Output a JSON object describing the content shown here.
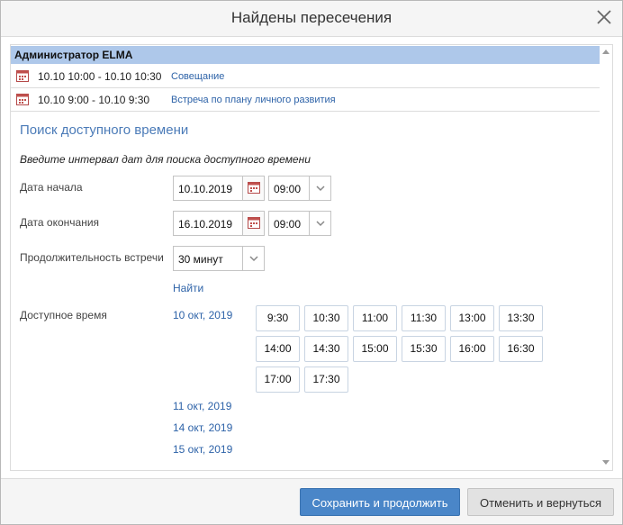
{
  "dialog": {
    "title": "Найдены пересечения"
  },
  "conflicts": {
    "user": "Администратор ELMA",
    "events": [
      {
        "time": "10.10 10:00 - 10.10 10:30",
        "name": "Совещание"
      },
      {
        "time": "10.10 9:00 - 10.10 9:30",
        "name": "Встреча по плану личного развития"
      }
    ]
  },
  "search": {
    "title": "Поиск доступного времени",
    "hint": "Введите интервал дат для поиска доступного времени",
    "start_label": "Дата начала",
    "start_date": "10.10.2019",
    "start_time": "09:00",
    "end_label": "Дата окончания",
    "end_date": "16.10.2019",
    "end_time": "09:00",
    "duration_label": "Продолжительность встречи",
    "duration": "30 минут",
    "find_link": "Найти"
  },
  "available": {
    "label": "Доступное время",
    "days": [
      {
        "date": "10 окт, 2019",
        "slots": [
          "9:30",
          "10:30",
          "11:00",
          "11:30",
          "13:00",
          "13:30",
          "14:00",
          "14:30",
          "15:00",
          "15:30",
          "16:00",
          "16:30",
          "17:00",
          "17:30"
        ]
      },
      {
        "date": "11 окт, 2019"
      },
      {
        "date": "14 окт, 2019"
      },
      {
        "date": "15 окт, 2019"
      }
    ]
  },
  "footer": {
    "save_label": "Сохранить и продолжить",
    "cancel_label": "Отменить и вернуться"
  },
  "colors": {
    "accent": "#4a86c8",
    "link": "#2e63a8",
    "header_bg": "#aec8ea"
  },
  "icons": [
    "close-icon",
    "calendar-event-icon",
    "calendar-icon",
    "chevron-down-icon",
    "scroll-up-icon",
    "scroll-down-icon"
  ]
}
